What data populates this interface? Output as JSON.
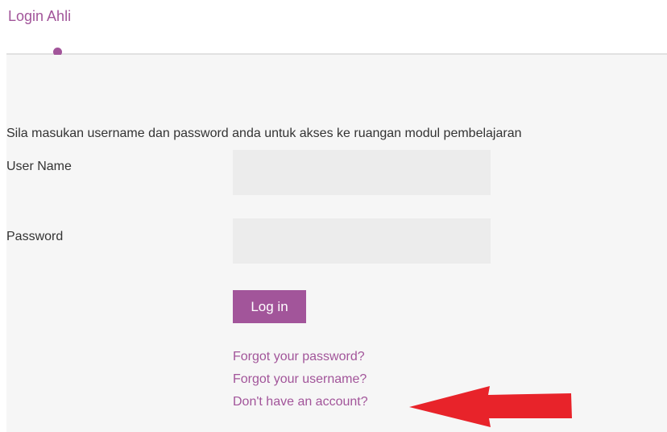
{
  "header": {
    "title": "Login Ahli",
    "accent_color": "#a2559a"
  },
  "form": {
    "intro": "Sila masukan username dan password anda untuk akses ke ruangan modul pembelajaran",
    "username_label": "User Name",
    "username_value": "",
    "password_label": "Password",
    "password_value": "",
    "login_label": "Log in"
  },
  "links": {
    "forgot_password": "Forgot your password?",
    "forgot_username": "Forgot your username?",
    "no_account": "Don't have an account?"
  },
  "annotation": {
    "arrow_color": "#e8232a",
    "arrow_icon": "red-arrow-left-icon"
  }
}
